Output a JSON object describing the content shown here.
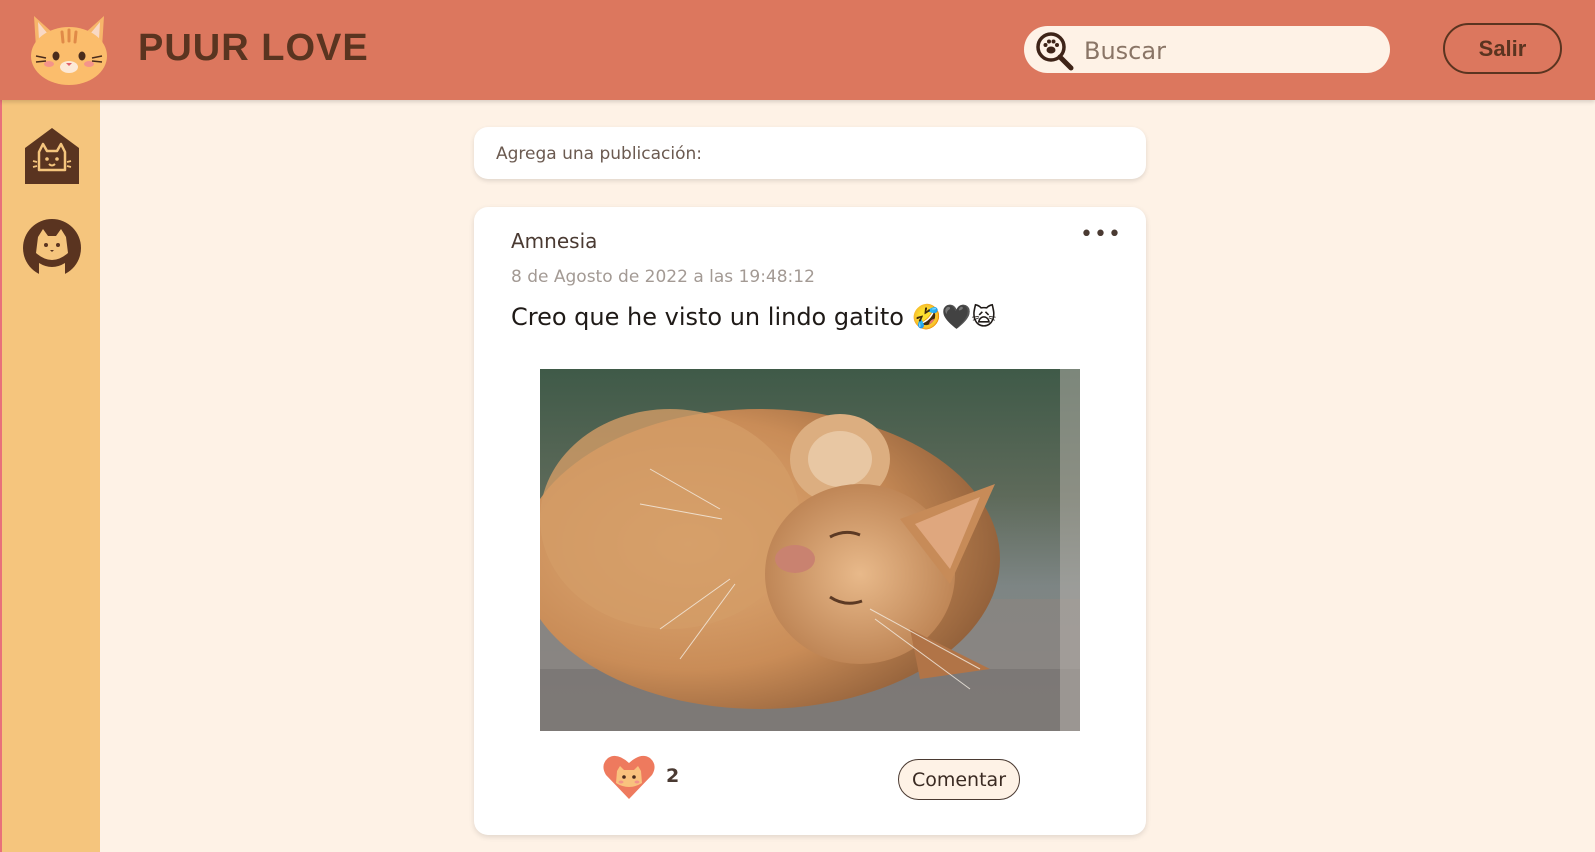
{
  "header": {
    "brand": "PUUR LOVE",
    "search_placeholder": "Buscar",
    "logout_label": "Salir"
  },
  "composer": {
    "placeholder": "Agrega una publicación:"
  },
  "post": {
    "author": "Amnesia",
    "timestamp": "8 de Agosto de 2022 a las 19:48:12",
    "text": "Creo que he visto un lindo gatito 🤣🖤🙀",
    "menu_label": "•••",
    "like_count": "2",
    "comment_label": "Comentar"
  },
  "colors": {
    "header": "#dc775e",
    "sidebar": "#f5c57d",
    "background": "#fef2e6",
    "accent_dark": "#5a3420"
  },
  "icons": {
    "logo": "cat-face-icon",
    "search": "paw-magnifier-icon",
    "home": "cat-house-icon",
    "profile": "cat-profile-icon",
    "like": "heart-cat-icon"
  }
}
